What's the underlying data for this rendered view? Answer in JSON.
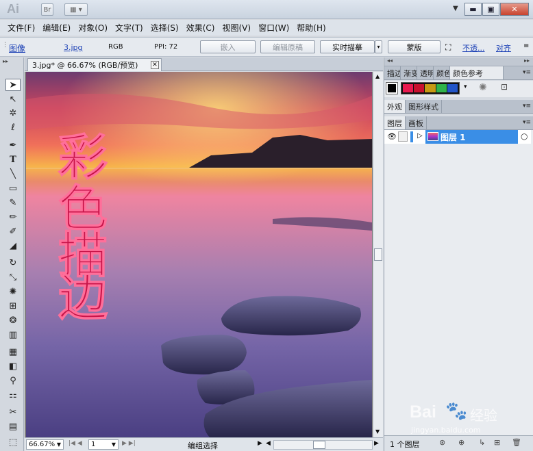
{
  "app": {
    "logo": "Ai",
    "bridge_btn": "Br"
  },
  "menu": [
    "文件(F)",
    "编辑(E)",
    "对象(O)",
    "文字(T)",
    "选择(S)",
    "效果(C)",
    "视图(V)",
    "窗口(W)",
    "帮助(H)"
  ],
  "control_bar": {
    "image_label": "图像",
    "file_link": "3.jpg",
    "color_mode": "RGB",
    "ppi": "PPI: 72",
    "embed_btn": "嵌入",
    "edit_original_btn": "编辑原稿",
    "live_trace_btn": "实时描摹",
    "mask_btn": "蒙版",
    "opacity_link": "不透...",
    "align_link": "对齐"
  },
  "document": {
    "tab_title": "3.jpg* @ 66.67% (RGB/预览)",
    "artwork_text": [
      "彩",
      "色",
      "描",
      "边"
    ],
    "zoom": "66.67%",
    "page": "1",
    "status": "编组选择"
  },
  "panels": {
    "top_tabs": [
      "描边",
      "渐变",
      "透明",
      "颜色",
      "颜色参考"
    ],
    "swatch_colors": [
      "#e8194e",
      "#c8112e",
      "#c79a12",
      "#2fb34a",
      "#2255c8"
    ],
    "appearance_tabs": [
      "外观",
      "图形样式"
    ],
    "layers_tabs": [
      "图层",
      "画板"
    ],
    "layer_name": "图层 1",
    "layers_count": "1 个图层"
  },
  "watermark": {
    "brand": "Bai",
    "brand_suffix": "经验",
    "url": "jingyan.baidu.com"
  }
}
